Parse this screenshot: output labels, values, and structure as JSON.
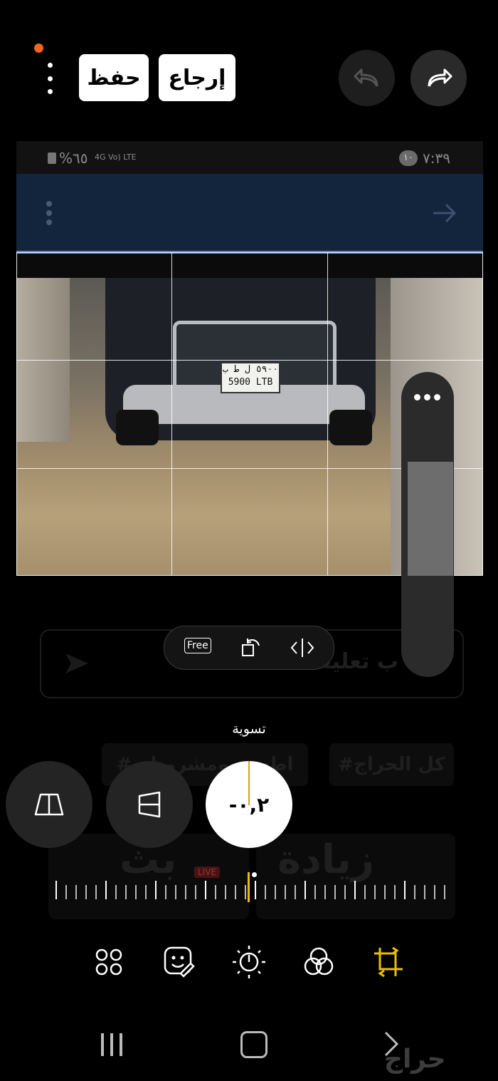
{
  "topbar": {
    "save_label": "حفظ",
    "revert_label": "إرجاع"
  },
  "inner_screen": {
    "status_time": "٧:٣٩",
    "status_badge": "١٠",
    "battery": "%٦٥",
    "network": "4G Vo) LTE",
    "plate_top": "٥٩٠٠ ل ط ب",
    "plate_bottom": "5900 LTB"
  },
  "background_page": {
    "comment_placeholder": "...ب تعليقك هنا",
    "tag_all": "#كل الحراج",
    "tag_parts": "#اطعمة ومشروبات",
    "card_increase": "زيادة",
    "card_live": "بث",
    "live_badge": "LIVE"
  },
  "crop_tools": {
    "free_label": "Free"
  },
  "adjust": {
    "label": "تسوية",
    "value": "-٠,٢"
  },
  "watermark": "حراج",
  "icons": [
    "more-icon",
    "undo-icon",
    "redo-icon",
    "rotate-icon",
    "flip-icon",
    "perspective-icon",
    "vertical-perspective-icon",
    "filters-icon",
    "stickers-icon",
    "brightness-icon",
    "color-icon",
    "crop-icon"
  ],
  "colors": {
    "accent": "#e8c000",
    "notification": "#f26522"
  }
}
